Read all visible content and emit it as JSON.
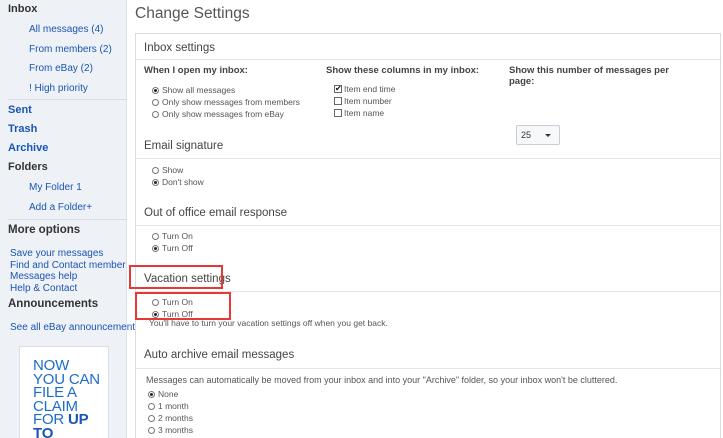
{
  "sidebar": {
    "inbox": "Inbox",
    "inbox_items": [
      "All messages (4)",
      "From members (2)",
      "From eBay (2)",
      "! High priority"
    ],
    "sent": "Sent",
    "trash": "Trash",
    "archive": "Archive",
    "folders": "Folders",
    "folder_items": [
      "My Folder 1",
      "Add a Folder+"
    ],
    "more_options": "More options",
    "more_links": [
      "Save your messages",
      "Find and Contact member",
      "Messages help",
      "Help & Contact"
    ],
    "announcements": "Announcements",
    "announcements_link": "See all eBay announcements",
    "promo": {
      "lines": [
        "NOW",
        "YOU CAN",
        "FILE A",
        "CLAIM"
      ],
      "last_prefix": "FOR ",
      "last_bold": "UP TO"
    }
  },
  "main": {
    "title": "Change Settings",
    "inbox_settings": {
      "title": "Inbox settings",
      "col1_head": "When I open my inbox:",
      "col1_options": [
        {
          "label": "Show all messages",
          "selected": true
        },
        {
          "label": "Only show messages from members",
          "selected": false
        },
        {
          "label": "Only show messages from eBay",
          "selected": false
        }
      ],
      "col2_head": "Show these columns in my inbox:",
      "col2_options": [
        {
          "label": "Item end time",
          "checked": true
        },
        {
          "label": "Item number",
          "checked": false
        },
        {
          "label": "Item name",
          "checked": false
        }
      ],
      "col3_head_1": "Show this number of messages per",
      "col3_head_2": "page:",
      "page_size": "25"
    },
    "email_signature": {
      "title": "Email signature",
      "options": [
        {
          "label": "Show",
          "selected": false
        },
        {
          "label": "Don't show",
          "selected": true
        }
      ]
    },
    "out_of_office": {
      "title": "Out of office email response",
      "options": [
        {
          "label": "Turn On",
          "selected": false
        },
        {
          "label": "Turn Off",
          "selected": true
        }
      ]
    },
    "vacation": {
      "title": "Vacation settings",
      "options": [
        {
          "label": "Turn On",
          "selected": false
        },
        {
          "label": "Turn Off",
          "selected": true
        }
      ],
      "note": "You'll have to turn your vacation settings off when you get back."
    },
    "auto_archive": {
      "title": "Auto archive email messages",
      "description": "Messages can automatically be moved from your inbox and into your \"Archive\" folder, so your inbox won't be cluttered.",
      "options": [
        {
          "label": "None",
          "selected": true
        },
        {
          "label": "1 month",
          "selected": false
        },
        {
          "label": "2 months",
          "selected": false
        },
        {
          "label": "3 months",
          "selected": false
        }
      ]
    }
  },
  "colors": {
    "link": "#1a55b5",
    "sidebar_bg": "#eef1f6",
    "highlight": "#e53935"
  }
}
